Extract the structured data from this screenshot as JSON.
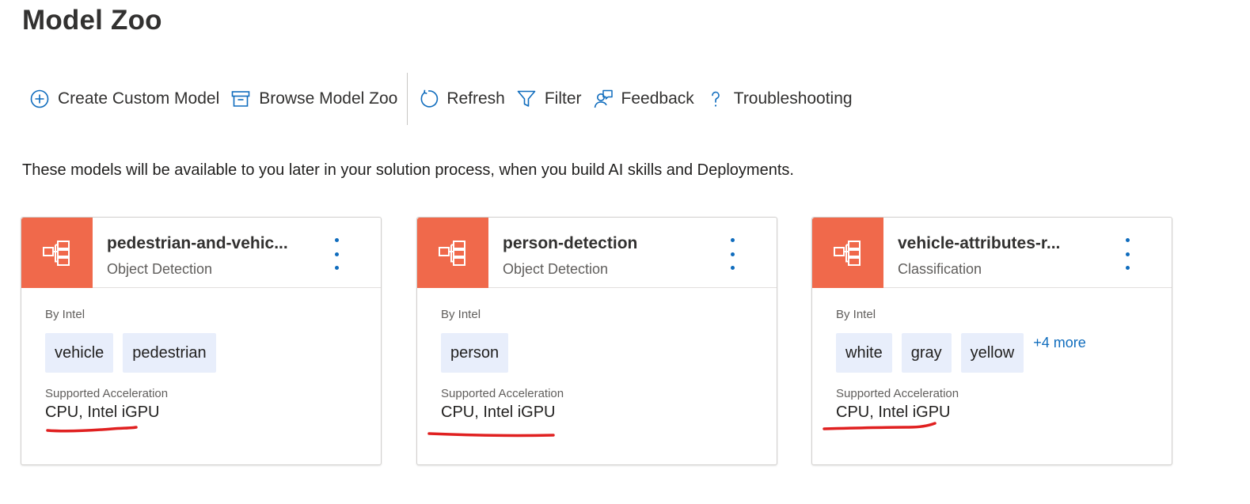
{
  "page": {
    "title": "Model Zoo"
  },
  "toolbar": {
    "create_custom_model": "Create Custom Model",
    "browse_model_zoo": "Browse Model Zoo",
    "refresh": "Refresh",
    "filter": "Filter",
    "feedback": "Feedback",
    "troubleshooting": "Troubleshooting"
  },
  "intro": "These models will be available to you later in your solution process, when you build AI skills and Deployments.",
  "colors": {
    "accent": "#f0694b",
    "link": "#0f6cbd",
    "tag_bg": "#e8eefb",
    "annotation": "#e02020"
  },
  "cards": [
    {
      "title": "pedestrian-and-vehic...",
      "type": "Object Detection",
      "by": "By Intel",
      "tags": [
        "vehicle",
        "pedestrian"
      ],
      "more": "",
      "accel_label": "Supported Acceleration",
      "accel_value": "CPU, Intel iGPU"
    },
    {
      "title": "person-detection",
      "type": "Object Detection",
      "by": "By Intel",
      "tags": [
        "person"
      ],
      "more": "",
      "accel_label": "Supported Acceleration",
      "accel_value": "CPU, Intel iGPU"
    },
    {
      "title": "vehicle-attributes-r...",
      "type": "Classification",
      "by": "By Intel",
      "tags": [
        "white",
        "gray",
        "yellow"
      ],
      "more": "+4 more",
      "accel_label": "Supported Acceleration",
      "accel_value": "CPU, Intel iGPU"
    }
  ]
}
